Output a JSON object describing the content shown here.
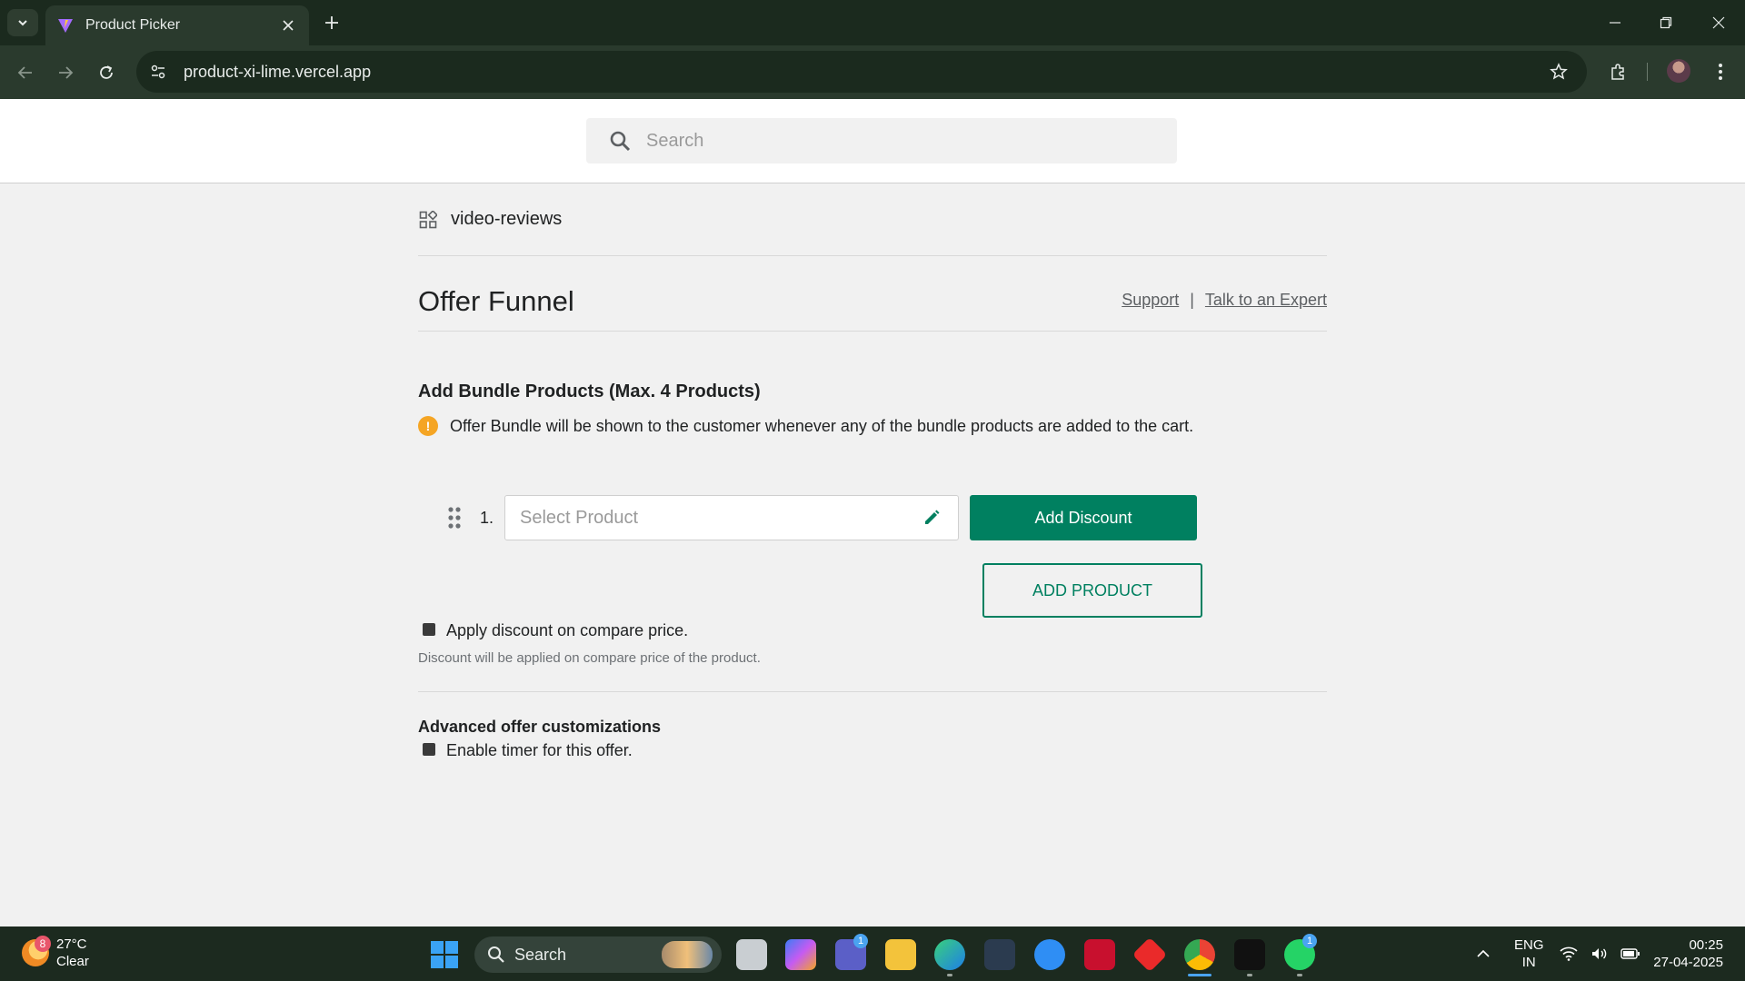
{
  "browser": {
    "tab_title": "Product Picker",
    "url": "product-xi-lime.vercel.app"
  },
  "header": {
    "search_placeholder": "Search"
  },
  "breadcrumb": {
    "label": "video-reviews"
  },
  "page": {
    "title": "Offer Funnel",
    "links": {
      "support": "Support",
      "separator": "|",
      "expert": "Talk to an Expert"
    }
  },
  "bundle": {
    "title": "Add Bundle Products (Max. 4 Products)",
    "info": "Offer Bundle will be shown to the customer whenever any of the bundle products are added to the cart.",
    "rows": [
      {
        "number": "1.",
        "placeholder": "Select Product",
        "discount_label": "Add Discount"
      }
    ],
    "add_product_label": "ADD PRODUCT",
    "compare_price_label": "Apply discount on compare price.",
    "compare_price_checked": false,
    "compare_price_helper": "Discount will be applied on compare price of the product."
  },
  "advanced": {
    "title": "Advanced offer customizations",
    "timer_label": "Enable timer for this offer.",
    "timer_checked": false
  },
  "taskbar": {
    "weather": {
      "temp": "27°C",
      "condition": "Clear",
      "badge": "8"
    },
    "search_label": "Search",
    "teams_badge": "1",
    "whatsapp_badge": "1",
    "lang": {
      "line1": "ENG",
      "line2": "IN"
    },
    "time": "00:25",
    "date": "27-04-2025"
  },
  "colors": {
    "primary": "#008060",
    "warning": "#f5a524",
    "chrome_dark": "#1b2a1e",
    "chrome_toolbar": "#2a3a2d"
  }
}
